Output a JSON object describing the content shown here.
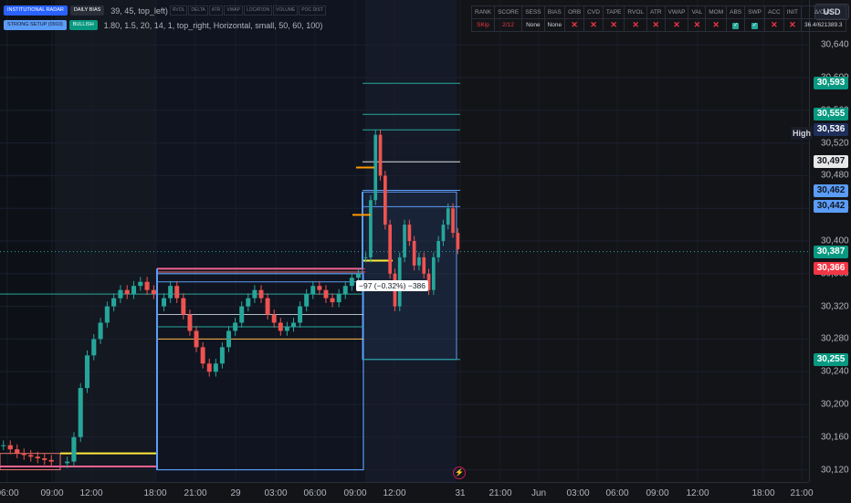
{
  "chart_data": {
    "type": "candlestick",
    "title": "",
    "y_ticks": [
      "30,640",
      "30,600",
      "30,560",
      "30,520",
      "30,480",
      "30,440",
      "30,400",
      "30,360",
      "30,320",
      "30,280",
      "30,240",
      "30,200",
      "30,160",
      "30,120"
    ],
    "x_ticks": [
      "06:00",
      "09:00",
      "12:00",
      "18:00",
      "21:00",
      "29",
      "03:00",
      "06:00",
      "09:00",
      "12:00",
      "31",
      "21:00",
      "Jun",
      "03:00",
      "06:00",
      "09:00",
      "12:00",
      "18:00",
      "21:00"
    ],
    "ylim": [
      30105,
      30695
    ],
    "price_tags": [
      {
        "label": "30,593",
        "value": 30593,
        "bg": "#089981",
        "fg": "#ffffff"
      },
      {
        "label": "30,555",
        "value": 30555,
        "bg": "#089981",
        "fg": "#ffffff"
      },
      {
        "label": "30,536",
        "value": 30536,
        "bg": "#1e2f5a",
        "fg": "#ffffff"
      },
      {
        "label": "30,497",
        "value": 30497,
        "bg": "#e8e8e8",
        "fg": "#131722"
      },
      {
        "label": "30,462",
        "value": 30462,
        "bg": "#5b9cf6",
        "fg": "#131722"
      },
      {
        "label": "30,442",
        "value": 30442,
        "bg": "#5b9cf6",
        "fg": "#131722"
      },
      {
        "label": "30,387",
        "value": 30387,
        "bg": "#089981",
        "fg": "#ffffff"
      },
      {
        "label": "30,366",
        "value": 30366,
        "bg": "#f23645",
        "fg": "#ffffff"
      },
      {
        "label": "30,255",
        "value": 30255,
        "bg": "#089981",
        "fg": "#ffffff"
      }
    ],
    "high_label": "High",
    "measure_label": "−97 (−0.32%) −386",
    "levels": [
      {
        "value": 30593,
        "color": "#26a69a",
        "from": "session-3"
      },
      {
        "value": 30555,
        "color": "#26a69a",
        "from": "session-3"
      },
      {
        "value": 30536,
        "color": "#26a69a",
        "from": "session-3"
      },
      {
        "value": 30497,
        "color": "#e0e0e0",
        "from": "session-3"
      },
      {
        "value": 30462,
        "color": "#5b9cf6",
        "from": "session-3"
      },
      {
        "value": 30442,
        "color": "#5b9cf6",
        "from": "session-3"
      },
      {
        "value": 30387,
        "color": "#26a69a",
        "from": "dotted"
      },
      {
        "value": 30376,
        "color": "#ffeb3b",
        "from": "session-3-short"
      },
      {
        "value": 30366,
        "color": "#f23645",
        "from": "session-2"
      },
      {
        "value": 30362,
        "color": "#e57373",
        "from": "session-2"
      },
      {
        "value": 30350,
        "color": "#5b9cf6",
        "from": "session-2-short"
      },
      {
        "value": 30335,
        "color": "#26a69a",
        "from": "session-0"
      },
      {
        "value": 30310,
        "color": "#b0bec5",
        "from": "session-2-short"
      },
      {
        "value": 30295,
        "color": "#26a69a",
        "from": "session-2-short"
      },
      {
        "value": 30280,
        "color": "#ffb74d",
        "from": "session-2-short"
      },
      {
        "value": 30255,
        "color": "#26a69a",
        "from": "session-3"
      }
    ],
    "series": [
      {
        "name": "",
        "session": 0,
        "open": 30150,
        "values": [
          30150,
          30145,
          30140,
          30138,
          30136,
          30134,
          30132,
          30130
        ]
      },
      {
        "name": "",
        "session": 1,
        "open": 30128,
        "values": [
          30130,
          30160,
          30220,
          30260,
          30280,
          30300,
          30320,
          30330,
          30340,
          30335,
          30345,
          30350,
          30340,
          30335
        ]
      },
      {
        "name": "",
        "session": 2,
        "open": 30320,
        "values": [
          30330,
          30345,
          30330,
          30310,
          30290,
          30270,
          30250,
          30240,
          30250,
          30270,
          30290,
          30300,
          30320,
          30330,
          30340,
          30330,
          30310,
          30300,
          30290,
          30295,
          30300,
          30320,
          30335,
          30345,
          30340,
          30330,
          30325,
          30335,
          30345,
          30355,
          30360
        ]
      },
      {
        "name": "",
        "session": 3,
        "open": 30380,
        "values": [
          30380,
          30450,
          30530,
          30480,
          30420,
          30360,
          30320,
          30380,
          30420,
          30400,
          30370,
          30380,
          30360,
          30340,
          30380,
          30400,
          30420,
          30440,
          30410,
          30390
        ]
      }
    ]
  },
  "status_table": {
    "headers": [
      "RANK",
      "SCORE",
      "SESS",
      "BIAS",
      "ORB",
      "CVD",
      "TAPE",
      "RVOL",
      "ATR",
      "VWAP",
      "VAL",
      "MOM",
      "ABS",
      "SWP",
      "ACC",
      "INIT",
      "Δ/CVD"
    ],
    "values": [
      "SKip",
      "2/12",
      "None",
      "None",
      "x",
      "x",
      "x",
      "x",
      "x",
      "x",
      "x",
      "x",
      "ok",
      "ok",
      "x",
      "x",
      "36.4/621389.3"
    ]
  },
  "top_left": {
    "badge1": "INSTITUTIONAL RADAR",
    "badge2": "DAILY BIAS",
    "cells": [
      "RVOL",
      "DELTA",
      "ATR",
      "VWAP",
      "LOCATION",
      "VOLUME",
      "POC DIST"
    ],
    "badge3": "STRONG SETUP (0910)",
    "badge4": "BULLISH",
    "line1": "39, 45, top_left)",
    "line2": "1.80, 1.5, 20, 14, 1, top_right, Horizontal, small, 50, 60, 100)"
  },
  "currency": "USD"
}
